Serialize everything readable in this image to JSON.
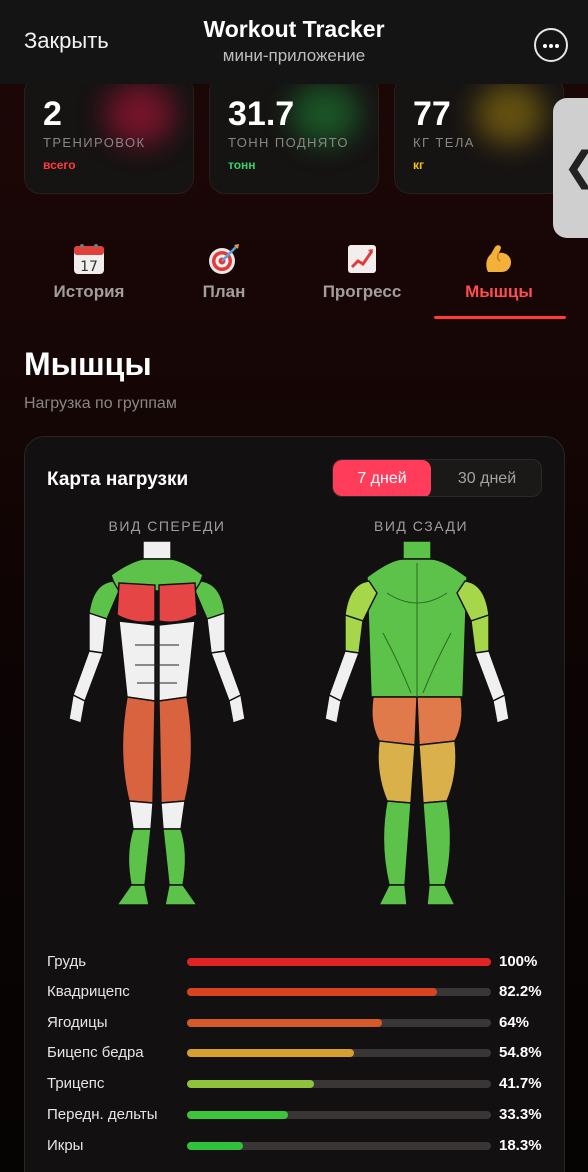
{
  "header": {
    "close_label": "Закрыть",
    "title": "Workout Tracker",
    "subtitle": "мини-приложение",
    "more_icon": "ellipsis-icon"
  },
  "stats": [
    {
      "value": "2",
      "label": "ТРЕНИРОВОК",
      "unit": "всего",
      "unit_color": "#ff3b3b",
      "glow": "#c4163e"
    },
    {
      "value": "31.7",
      "label": "ТОНН ПОДНЯТО",
      "unit": "тонн",
      "unit_color": "#35d26b",
      "glow": "#1f8a36"
    },
    {
      "value": "77",
      "label": "КГ ТЕЛА",
      "unit": "кг",
      "unit_color": "#f2c21b",
      "glow": "#a5850f"
    }
  ],
  "side_handle": {
    "icon": "chevron-left-icon",
    "glyph": "❮"
  },
  "tabs": [
    {
      "label": "История",
      "icon": "calendar-icon",
      "active": false
    },
    {
      "label": "План",
      "icon": "target-icon",
      "active": false
    },
    {
      "label": "Прогресс",
      "icon": "chart-icon",
      "active": false
    },
    {
      "label": "Мышцы",
      "icon": "biceps-icon",
      "active": true
    }
  ],
  "page": {
    "title": "Мышцы",
    "subtitle": "Нагрузка по группам"
  },
  "card": {
    "title": "Карта нагрузки",
    "periods": [
      "7 дней",
      "30 дней"
    ],
    "selected_period": "7 дней",
    "front_label": "ВИД СПЕРЕДИ",
    "back_label": "ВИД СЗАДИ"
  },
  "bars": [
    {
      "name": "Грудь",
      "percent": 100,
      "label": "100%",
      "color": "#e02424"
    },
    {
      "name": "Квадрицепс",
      "percent": 82.2,
      "label": "82.2%",
      "color": "#d9431f"
    },
    {
      "name": "Ягодицы",
      "percent": 64,
      "label": "64%",
      "color": "#d65a28"
    },
    {
      "name": "Бицепс бедра",
      "percent": 54.8,
      "label": "54.8%",
      "color": "#d6a030"
    },
    {
      "name": "Трицепс",
      "percent": 41.7,
      "label": "41.7%",
      "color": "#8fc43a"
    },
    {
      "name": "Передн. дельты",
      "percent": 33.3,
      "label": "33.3%",
      "color": "#3cc43a"
    },
    {
      "name": "Икры",
      "percent": 18.3,
      "label": "18.3%",
      "color": "#2fc23a"
    }
  ]
}
